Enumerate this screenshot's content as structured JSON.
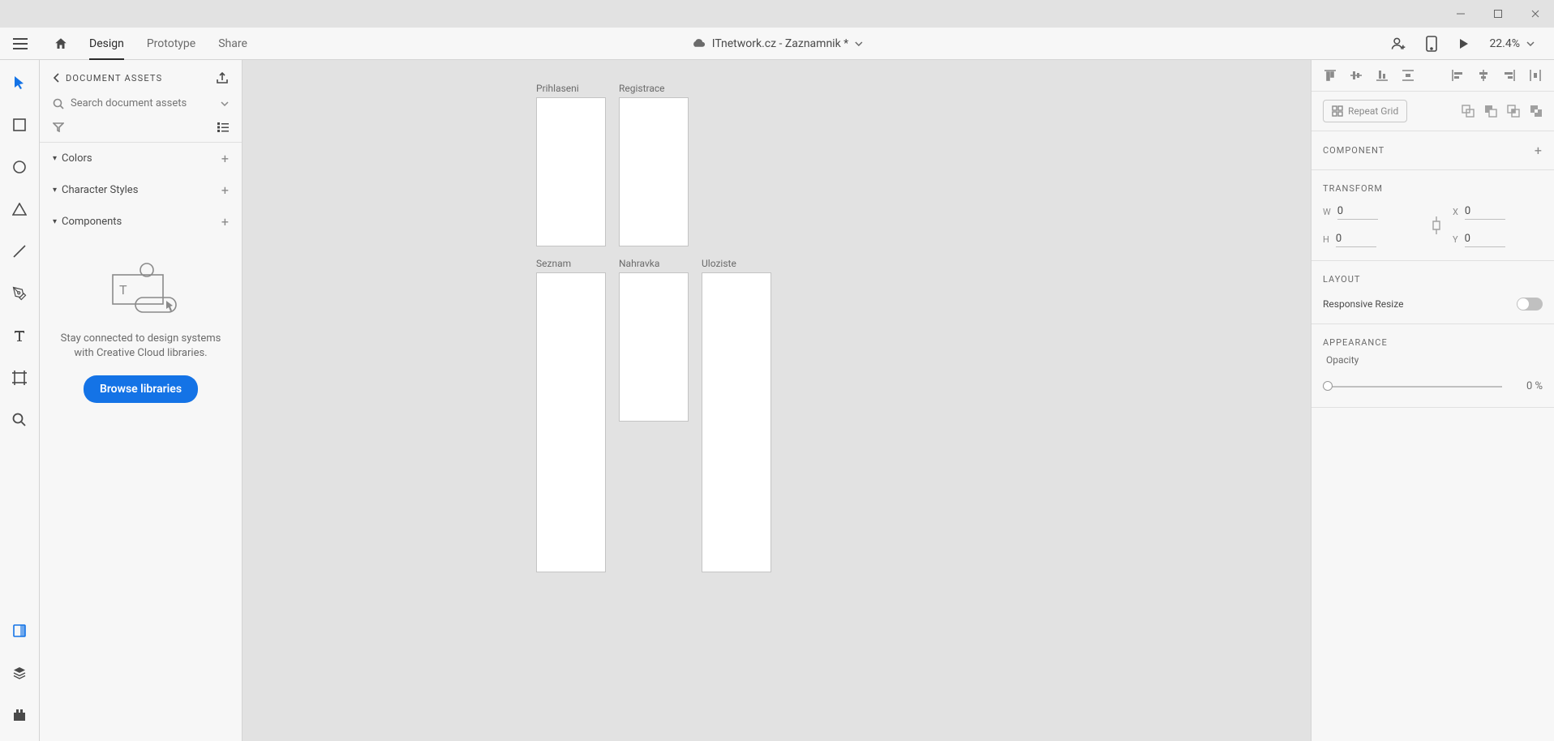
{
  "window": {
    "title": "ITnetwork.cz - Zaznamnik *"
  },
  "menubar": {
    "modes": {
      "design": "Design",
      "prototype": "Prototype",
      "share": "Share"
    },
    "zoom": "22.4%"
  },
  "assets": {
    "title": "DOCUMENT ASSETS",
    "search_placeholder": "Search document assets",
    "sections": {
      "colors": "Colors",
      "char_styles": "Character Styles",
      "components": "Components"
    },
    "empty_msg": "Stay connected to design systems with Creative Cloud libraries.",
    "browse_label": "Browse libraries"
  },
  "artboards": {
    "a1": {
      "label": "Prihlaseni"
    },
    "a2": {
      "label": "Registrace"
    },
    "a3": {
      "label": "Seznam"
    },
    "a4": {
      "label": "Nahravka"
    },
    "a5": {
      "label": "Uloziste"
    }
  },
  "rightpanel": {
    "repeat_grid": "Repeat Grid",
    "component": "COMPONENT",
    "transform": {
      "title": "TRANSFORM",
      "w": "0",
      "h": "0",
      "x": "0",
      "y": "0"
    },
    "layout": {
      "title": "LAYOUT",
      "responsive": "Responsive Resize"
    },
    "appearance": {
      "title": "APPEARANCE",
      "opacity_label": "Opacity",
      "opacity_value": "0 %"
    }
  }
}
